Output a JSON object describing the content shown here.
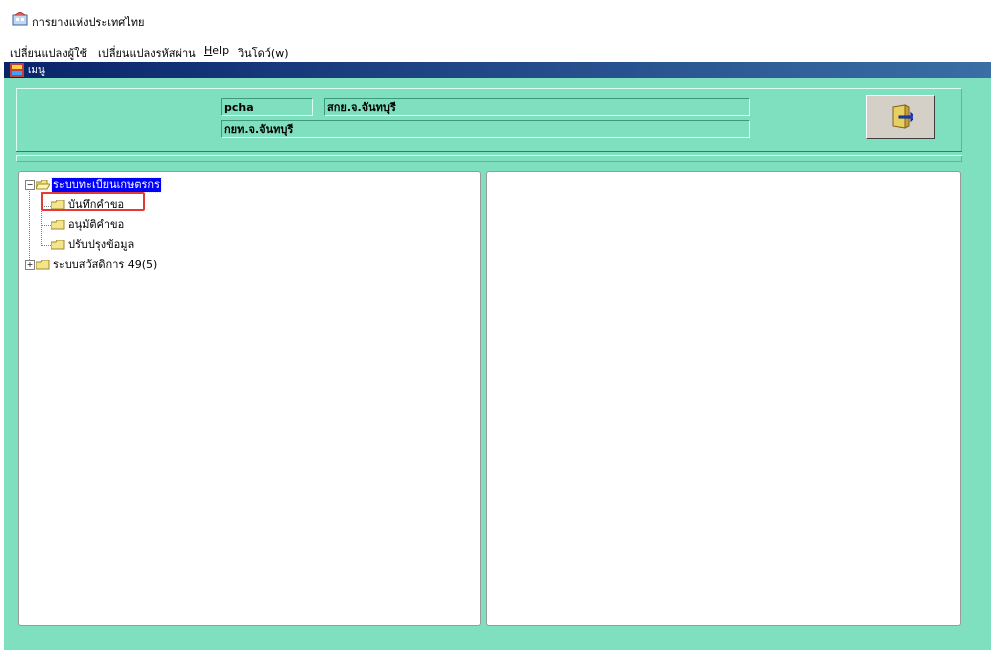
{
  "app": {
    "title": "การยางแห่งประเทศไทย"
  },
  "menubar": {
    "items": [
      {
        "label": "เปลี่ยนแปลงผู้ใช้"
      },
      {
        "label": "เปลี่ยนแปลงรหัสผ่าน"
      },
      {
        "label": "Help"
      },
      {
        "label": "วินโดว์(w)"
      }
    ]
  },
  "window": {
    "title": "เมนู"
  },
  "header": {
    "user_id": "pcha",
    "office": "สกย.จ.จันทบุรี",
    "department": "กยท.จ.จันทบุรี"
  },
  "tree": {
    "nodes": [
      {
        "label": "ระบบทะเบียนเกษตรกร",
        "expanded": true,
        "selected": true
      },
      {
        "label": "บันทึกคำขอ",
        "highlighted": true
      },
      {
        "label": "อนุมัติคำขอ"
      },
      {
        "label": "ปรับปรุงข้อมูล"
      },
      {
        "label": "ระบบสวัสดิการ 49(5)",
        "expanded": false
      }
    ]
  },
  "colors": {
    "workspace_bg": "#7fe0c0",
    "title_gradient_start": "#0a246a",
    "selection": "#0000ff",
    "highlight_box": "#e53935"
  }
}
